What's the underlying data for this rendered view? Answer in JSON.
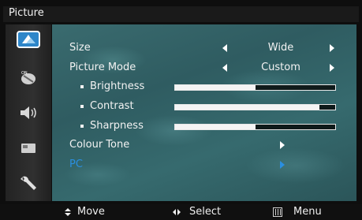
{
  "menu": {
    "title": "Picture"
  },
  "sidebar": {
    "items": [
      {
        "icon": "picture-icon",
        "active": true
      },
      {
        "icon": "sound-on-icon",
        "active": false
      },
      {
        "icon": "speaker-icon",
        "active": false
      },
      {
        "icon": "setup-icon",
        "active": false
      },
      {
        "icon": "wrench-icon",
        "active": false
      }
    ]
  },
  "options": {
    "size": {
      "label": "Size",
      "value": "Wide"
    },
    "picture_mode": {
      "label": "Picture Mode",
      "value": "Custom"
    },
    "brightness": {
      "label": "Brightness",
      "level": 0.5
    },
    "contrast": {
      "label": "Contrast",
      "level": 0.9
    },
    "sharpness": {
      "label": "Sharpness",
      "level": 0.5
    },
    "colour_tone": {
      "label": "Colour Tone"
    },
    "pc": {
      "label": "PC",
      "selected": true
    }
  },
  "footer": {
    "move": "Move",
    "select": "Select",
    "menu": "Menu"
  },
  "colors": {
    "highlight": "#2a8fe0",
    "panel": "#33666a",
    "frame": "#0e0e0e"
  }
}
